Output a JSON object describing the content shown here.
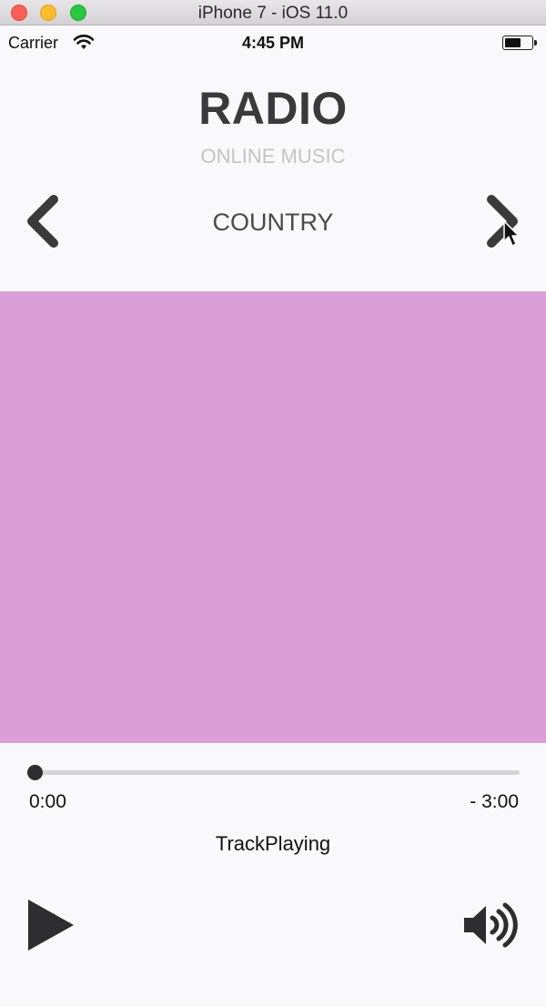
{
  "window": {
    "title": "iPhone 7 - iOS 11.0"
  },
  "status_bar": {
    "carrier": "Carrier",
    "time": "4:45 PM",
    "battery_level": 0.6
  },
  "header": {
    "title": "RADIO",
    "subtitle": "ONLINE MUSIC"
  },
  "genre_selector": {
    "current": "COUNTRY",
    "prev_icon": "chevron-left-icon",
    "next_icon": "chevron-right-icon"
  },
  "artwork": {
    "color": "#d99fd6"
  },
  "player": {
    "elapsed": "0:00",
    "remaining": "- 3:00",
    "progress": 0.0,
    "track": "TrackPlaying",
    "play_icon": "play-icon",
    "volume_icon": "speaker-volume-icon"
  },
  "colors": {
    "accent_dark": "#3a3a3c",
    "background": "#f9f8fb"
  }
}
